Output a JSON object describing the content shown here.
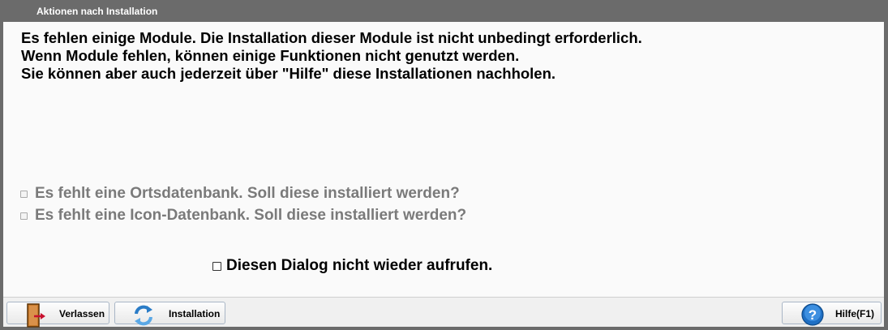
{
  "window": {
    "title": "Aktionen nach Installation"
  },
  "message": {
    "line1": "Es fehlen einige Module. Die Installation dieser Module ist nicht unbedingt erforderlich.",
    "line2": "Wenn Module fehlen, können einige Funktionen nicht genutzt werden.",
    "line3": "Sie können aber auch jederzeit über \"Hilfe\" diese Installationen nachholen."
  },
  "options": {
    "ortsdatenbank": {
      "label": "Es fehlt eine Ortsdatenbank. Soll diese installiert werden?",
      "checked": false,
      "enabled": false
    },
    "icondatenbank": {
      "label": "Es fehlt eine Icon-Datenbank. Soll diese installiert werden?",
      "checked": false,
      "enabled": false
    },
    "dont_show_again": {
      "label": "Diesen Dialog nicht wieder aufrufen.",
      "checked": false,
      "enabled": true
    }
  },
  "footer": {
    "exit_label": "Verlassen",
    "exit_icon": "door-exit-icon",
    "install_label": "Installation",
    "install_icon": "refresh-icon",
    "help_label": "Hilfe(F1)",
    "help_icon": "help-question-icon"
  }
}
